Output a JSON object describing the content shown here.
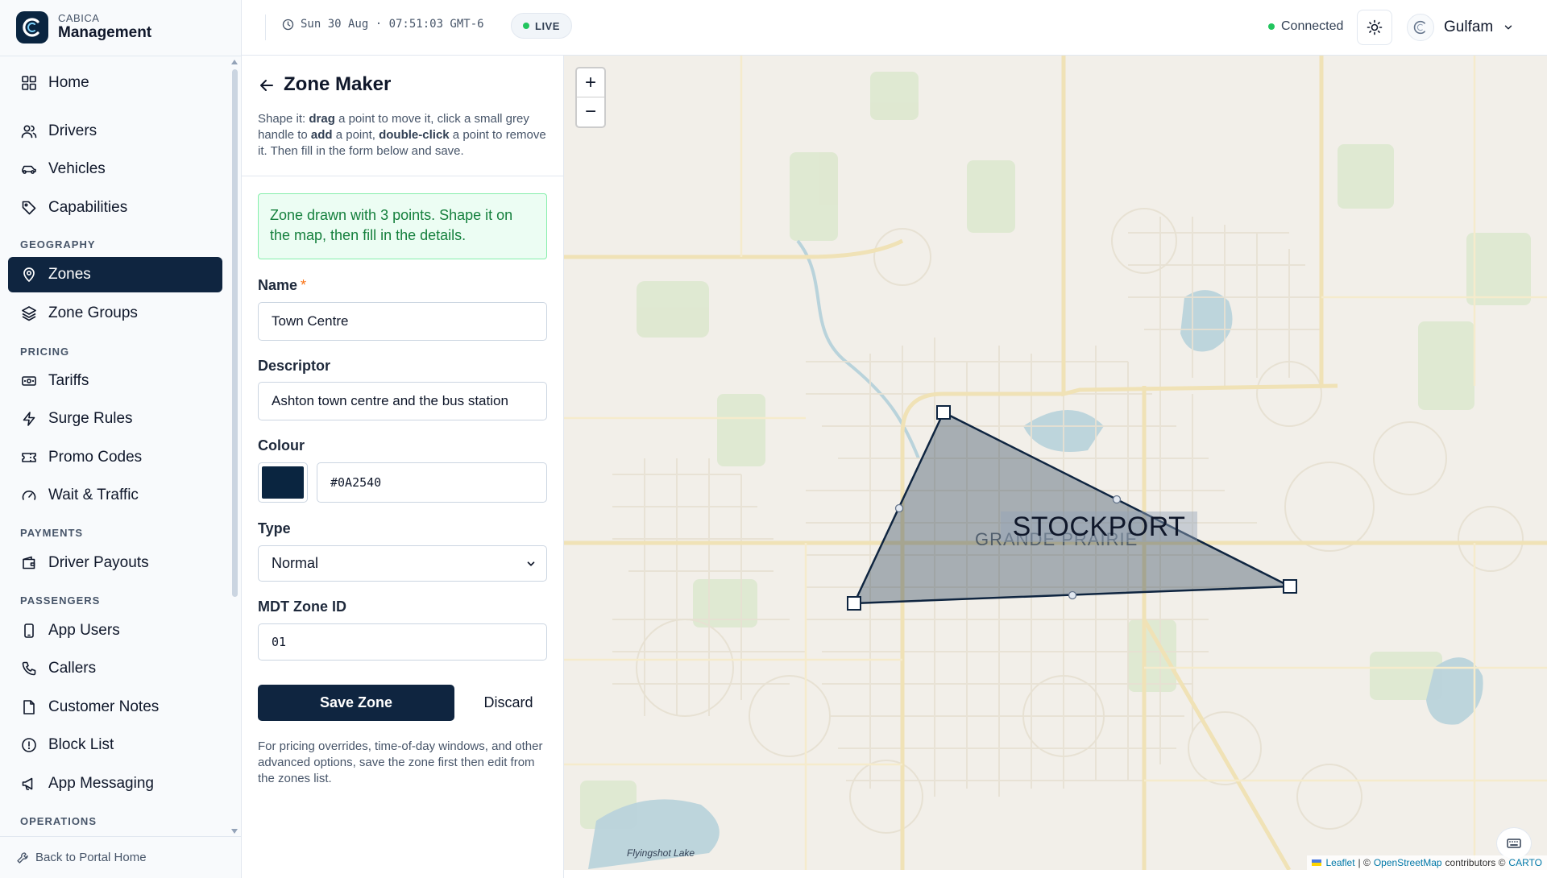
{
  "brand": {
    "sub": "CABICA",
    "title": "Management"
  },
  "nav": {
    "home": "Home",
    "drivers": "Drivers",
    "vehicles": "Vehicles",
    "capabilities": "Capabilities",
    "section_geography": "GEOGRAPHY",
    "zones": "Zones",
    "zone_groups": "Zone Groups",
    "section_pricing": "PRICING",
    "tariffs": "Tariffs",
    "surge_rules": "Surge Rules",
    "promo_codes": "Promo Codes",
    "wait_traffic": "Wait & Traffic",
    "section_payments": "PAYMENTS",
    "driver_payouts": "Driver Payouts",
    "section_passengers": "PASSENGERS",
    "app_users": "App Users",
    "callers": "Callers",
    "customer_notes": "Customer Notes",
    "block_list": "Block List",
    "app_messaging": "App Messaging",
    "section_operations": "OPERATIONS",
    "active_item": "Zones"
  },
  "sidebar_footer": "Back to Portal Home",
  "topbar": {
    "clock": "Sun 30 Aug · 07:51:03 GMT-6",
    "live": "LIVE",
    "connection": "Connected",
    "username": "Gulfam"
  },
  "panel": {
    "title": "Zone Maker",
    "help": {
      "t1": "Shape it: ",
      "b1": "drag",
      "t2": " a point to move it, click a small grey handle to ",
      "b2": "add",
      "t3": " a point, ",
      "b3": "double-click",
      "t4": " a point to remove it. Then fill in the form below and save."
    },
    "notice": "Zone drawn with 3 points. Shape it on the map, then fill in the details.",
    "form": {
      "name_label": "Name",
      "required_mark": "*",
      "name_value": "Town Centre",
      "descriptor_label": "Descriptor",
      "descriptor_value": "Ashton town centre and the bus station",
      "colour_label": "Colour",
      "colour_value": "#0A2540",
      "type_label": "Type",
      "type_value": "Normal",
      "mdt_label": "MDT Zone ID",
      "mdt_value": "01"
    },
    "save_label": "Save Zone",
    "discard_label": "Discard",
    "footer": "For pricing overrides, time-of-day windows, and other advanced options, save the zone first then edit from the zones list."
  },
  "map": {
    "zone_label": "STOCKPORT",
    "city_label": "GRANDE PRAIRIE",
    "lake_label": "Flyingshot Lake",
    "zoom_in": "+",
    "zoom_out": "−",
    "attribution": {
      "leaflet": "Leaflet",
      "sep": "| ©",
      "osm": "OpenStreetMap",
      "mid": "contributors ©",
      "carto": "CARTO"
    },
    "zone_color": "#0A2540"
  },
  "icons": {
    "home": "grid-icon",
    "drivers": "users-icon",
    "vehicles": "car-icon",
    "capabilities": "tag-icon",
    "zones": "map-pin-icon",
    "zone_groups": "layers-icon",
    "tariffs": "banknote-icon",
    "surge_rules": "zap-icon",
    "promo_codes": "ticket-icon",
    "wait_traffic": "gauge-icon",
    "driver_payouts": "wallet-icon",
    "app_users": "smartphone-icon",
    "callers": "phone-icon",
    "customer_notes": "file-icon",
    "block_list": "alert-circle-icon",
    "app_messaging": "megaphone-icon"
  }
}
